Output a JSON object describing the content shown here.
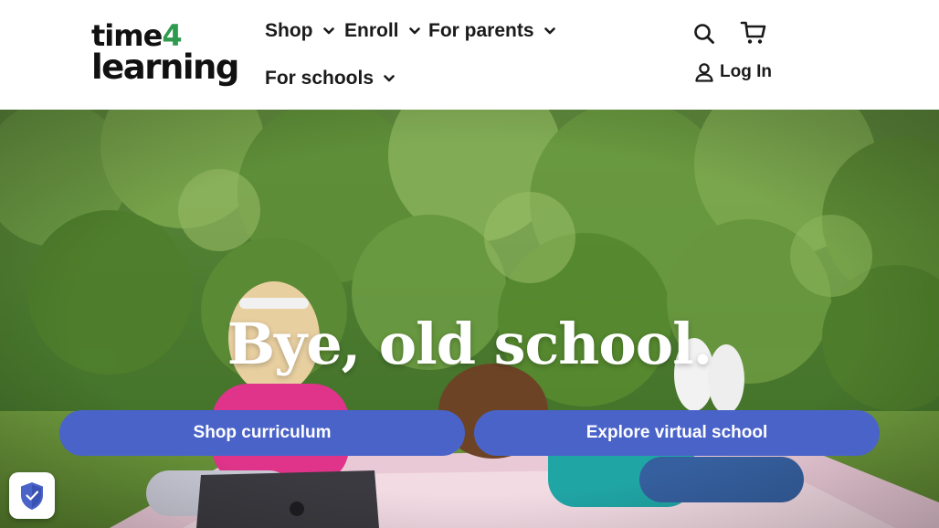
{
  "brand": {
    "logo_line1_prefix": "time",
    "logo_line1_accent": "4",
    "logo_line2": "learning",
    "accent_color": "#2e9a4e"
  },
  "nav": {
    "items": [
      {
        "label": "Shop",
        "icon": "chevron-down-icon"
      },
      {
        "label": "Enroll",
        "icon": "chevron-down-icon"
      },
      {
        "label": "For parents",
        "icon": "chevron-down-icon"
      },
      {
        "label": "For schools",
        "icon": "chevron-down-icon"
      }
    ]
  },
  "utility": {
    "search_icon": "search-icon",
    "cart_icon": "cart-icon",
    "login_icon": "user-icon",
    "login_label": "Log In"
  },
  "hero": {
    "title": "Bye, old school.",
    "cta_primary": "Shop curriculum",
    "cta_secondary": "Explore virtual school",
    "cta_color": "#4a63c9"
  },
  "privacy_badge": {
    "icon": "shield-check-icon"
  }
}
